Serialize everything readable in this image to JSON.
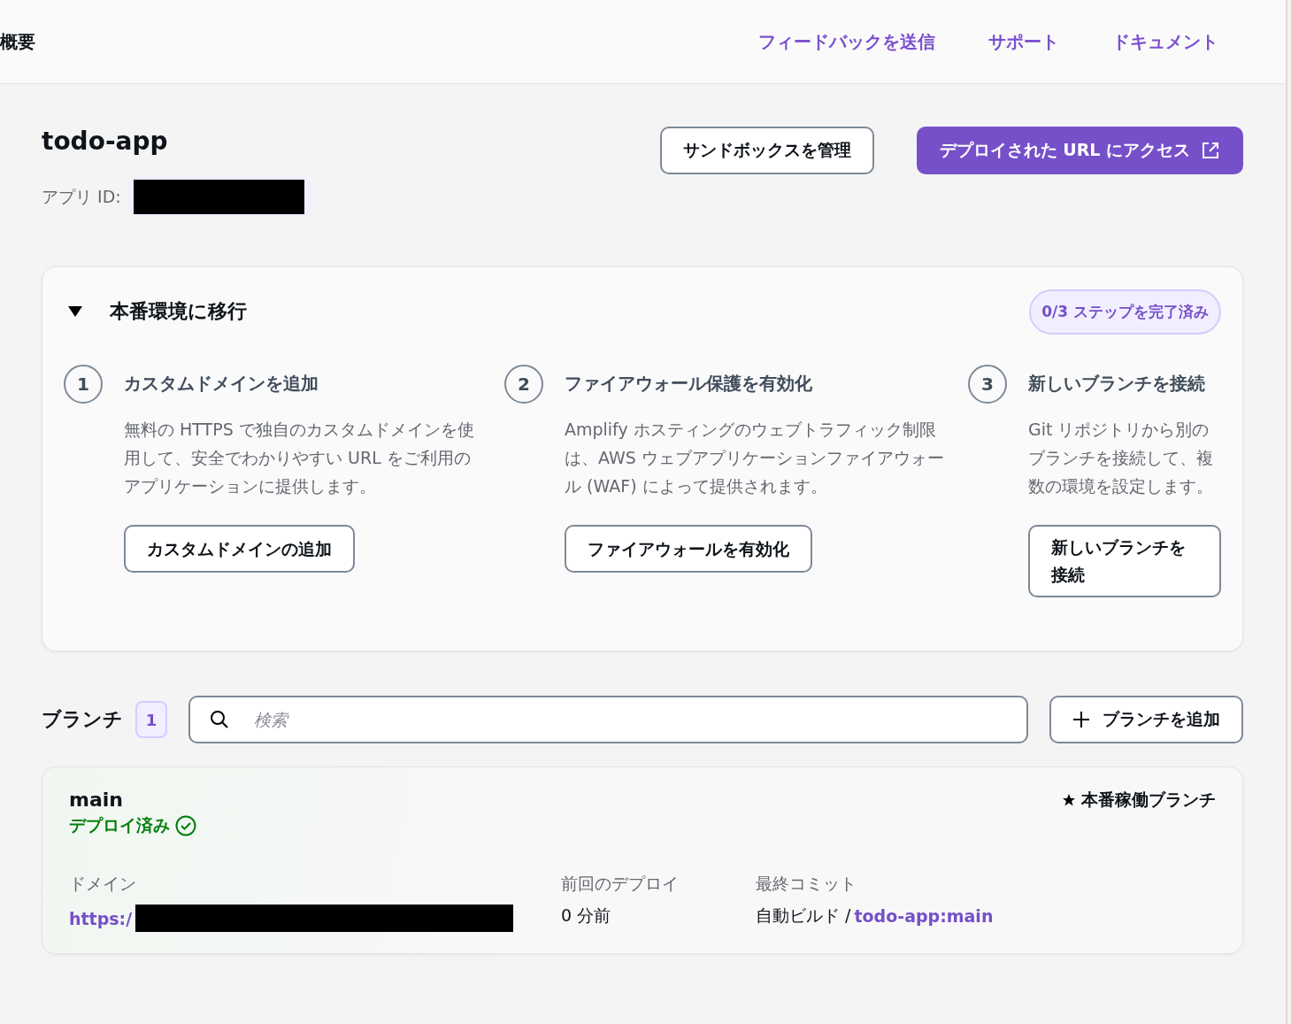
{
  "header": {
    "title": "概要",
    "links": [
      "フィードバックを送信",
      "サポート",
      "ドキュメント"
    ]
  },
  "app": {
    "name": "todo-app",
    "id_label": "アプリ ID:",
    "id_redacted": true,
    "buttons": [
      {
        "label": "サンドボックスを管理",
        "kind": "secondary"
      },
      {
        "label": "デプロイされた URL にアクセス",
        "kind": "primary"
      }
    ]
  },
  "production": {
    "title": "本番環境に移行",
    "expanded": true,
    "progress": "0/3 ステップを完了済み",
    "steps": [
      {
        "number": "1",
        "title": "カスタムドメインを追加",
        "description": "無料の HTTPS で独自のカスタムドメインを使用して、安全でわかりやすい URL をご利用のアプリケーションに提供します。",
        "button": "カスタムドメインの追加"
      },
      {
        "number": "2",
        "title": "ファイアウォール保護を有効化",
        "description": "Amplify ホスティングのウェブトラフィック制限は、AWS ウェブアプリケーションファイアウォール (WAF) によって提供されます。",
        "button": "ファイアウォールを有効化"
      },
      {
        "number": "3",
        "title": "新しいブランチを接続",
        "description": "Git リポジトリから別のブランチを接続して、複数の環境を設定します。",
        "button": "新しいブランチを接続"
      }
    ]
  },
  "branches": {
    "title": "ブランチ",
    "count": "1",
    "search": {
      "placeholder": "検索"
    },
    "add_button": "ブランチを追加",
    "items": [
      {
        "name": "main",
        "status": "デプロイ済み",
        "kind": "deployed",
        "production_label": "本番稼働ブランチ",
        "domain_label": "ドメイン",
        "domain": "https:/",
        "domain_redacted": true,
        "last_deploy_label": "前回のデプロイ",
        "last_deploy": "0 分前",
        "last_commit_label": "最終コミット",
        "commit_source": "自動ビルド /",
        "commit_link": "todo-app:main"
      }
    ]
  }
}
